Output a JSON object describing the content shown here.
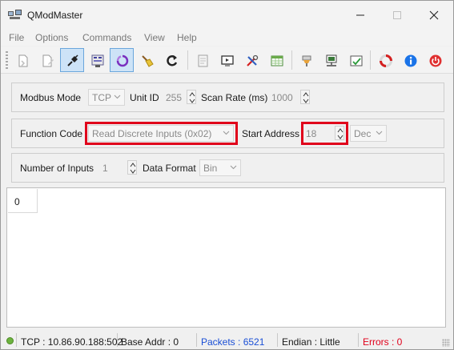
{
  "window": {
    "title": "QModMaster",
    "icons": {
      "app": "computer-network-icon",
      "minimize": "minimize-icon",
      "maximize": "maximize-icon",
      "close": "close-icon"
    }
  },
  "menu": [
    "File",
    "Options",
    "Commands",
    "View",
    "Help"
  ],
  "toolbar": {
    "buttons": [
      {
        "icon": "load-session-icon"
      },
      {
        "icon": "save-session-icon"
      },
      {
        "icon": "connect-icon",
        "checked": true
      },
      {
        "icon": "read-write-icon"
      },
      {
        "icon": "scan-icon",
        "checked": true
      },
      {
        "icon": "clear-broom-icon"
      },
      {
        "icon": "reset-counters-icon"
      },
      {
        "icon": "log-file-icon"
      },
      {
        "icon": "bus-monitor-icon"
      },
      {
        "icon": "tools-icon"
      },
      {
        "icon": "settings-table-icon"
      },
      {
        "icon": "modbus-rtu-icon"
      },
      {
        "icon": "modbus-tcp-icon"
      },
      {
        "icon": "settings-check-icon"
      },
      {
        "icon": "help-lifebuoy-icon"
      },
      {
        "icon": "about-info-icon"
      },
      {
        "icon": "exit-power-icon"
      }
    ]
  },
  "settings_row": {
    "modbus_mode_label": "Modbus Mode",
    "modbus_mode_value": "TCP",
    "unit_id_label": "Unit ID",
    "unit_id_value": "255",
    "scan_rate_label": "Scan Rate (ms)",
    "scan_rate_value": "1000"
  },
  "function_row": {
    "function_code_label": "Function Code",
    "function_code_value": "Read Discrete Inputs (0x02)",
    "start_address_label": "Start Address",
    "start_address_value": "18",
    "format_value": "Dec"
  },
  "inputs_row": {
    "number_of_inputs_label": "Number of Inputs",
    "number_of_inputs_value": "1",
    "data_format_label": "Data Format",
    "data_format_value": "Bin"
  },
  "table": {
    "cells": [
      "0"
    ]
  },
  "status": {
    "connection": "TCP : 10.86.90.188:502",
    "base_addr": "Base Addr : 0",
    "packets": "Packets : 6521",
    "endian": "Endian : Little",
    "errors": "Errors : 0"
  },
  "colors": {
    "highlight": "#e0001b",
    "packets": "#1a4fd6",
    "errors": "#e0001b",
    "status_led": "#6db33f",
    "checked_button": "#cde3f7"
  }
}
